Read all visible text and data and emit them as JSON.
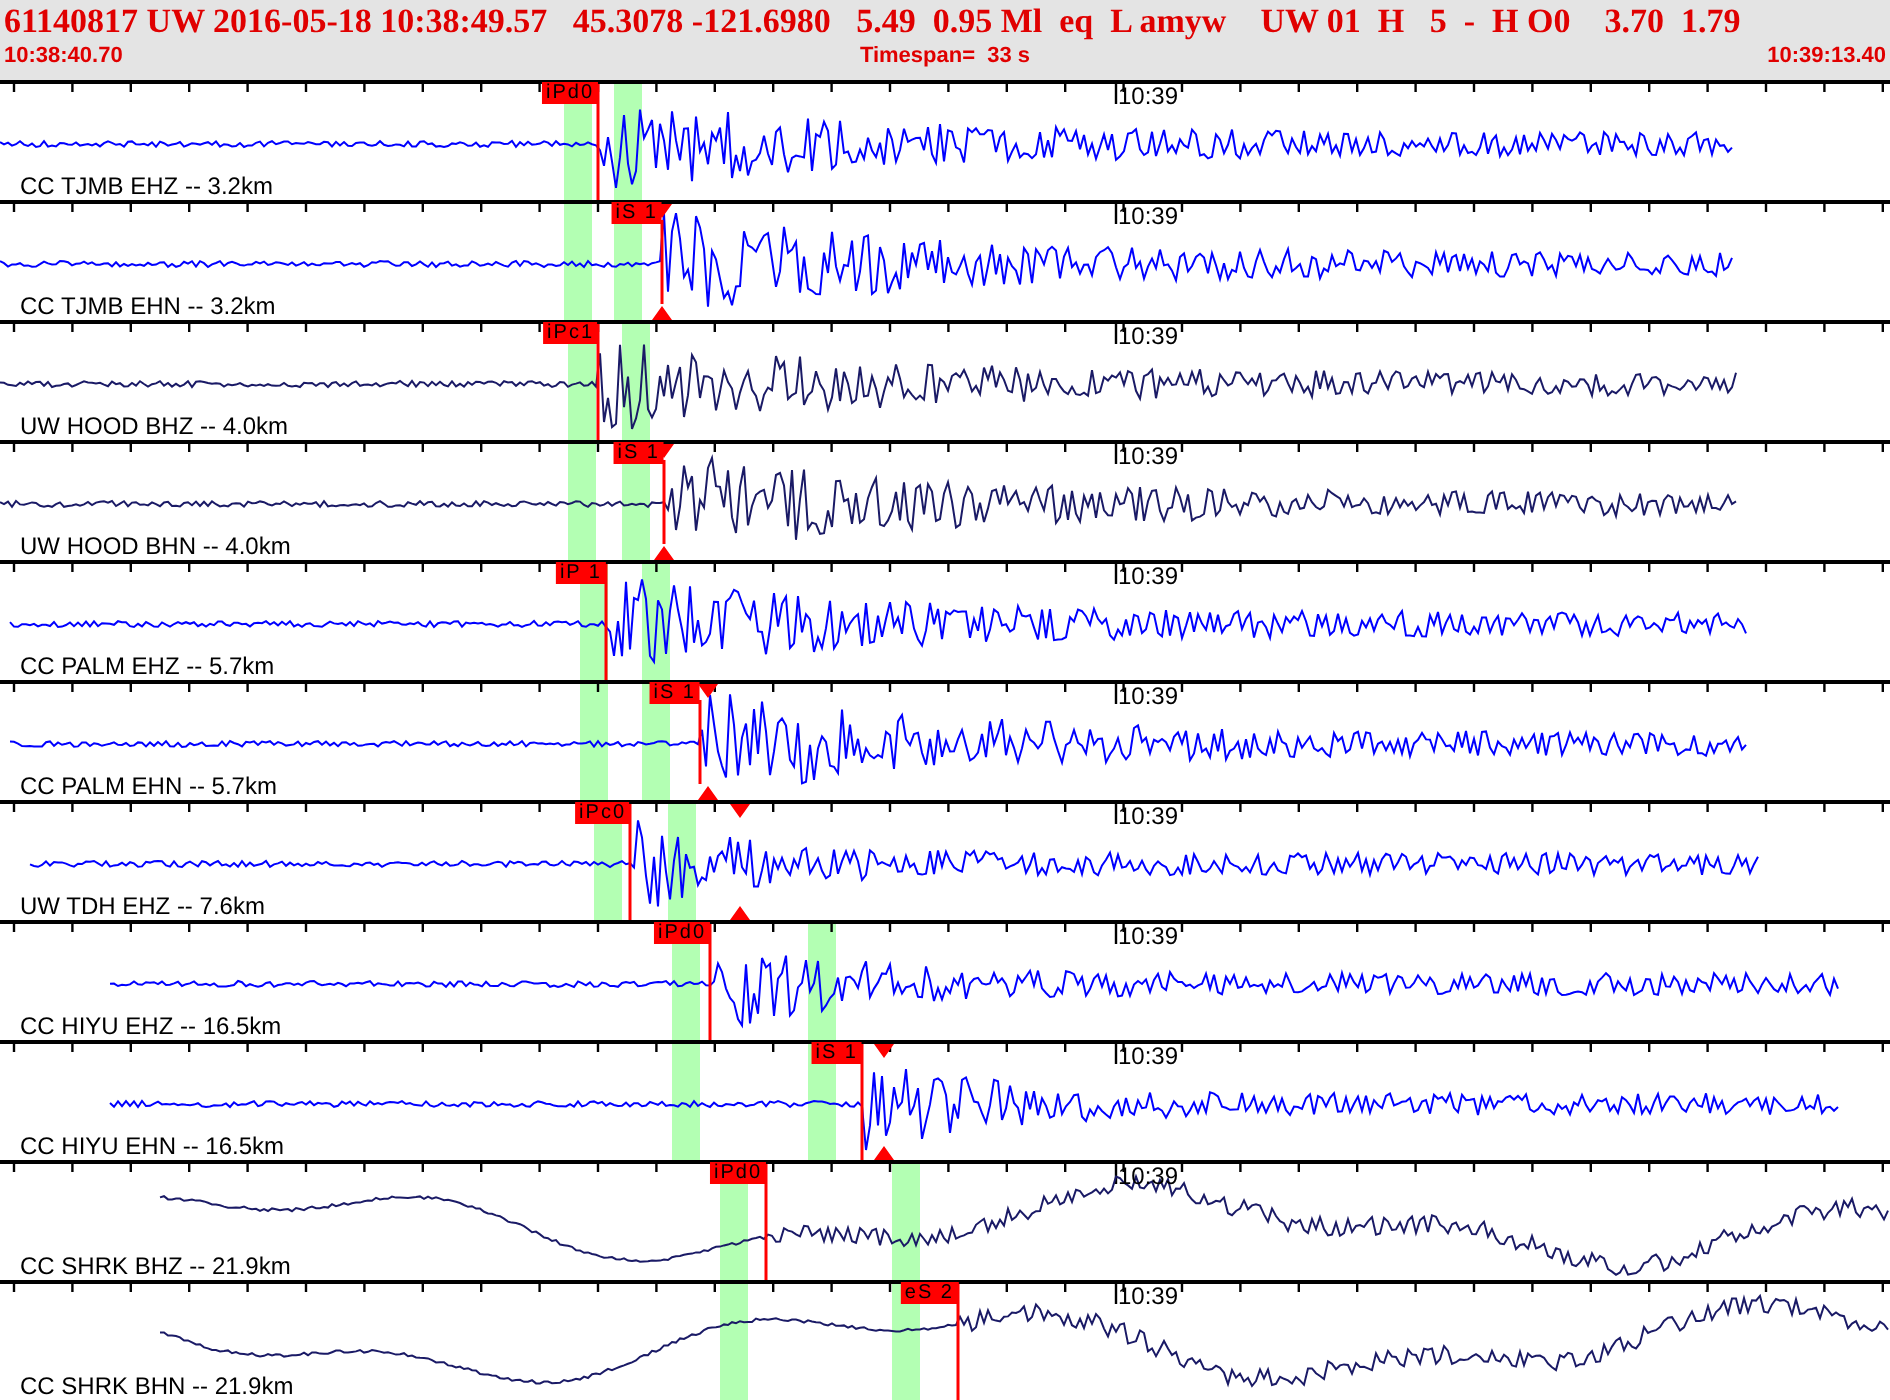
{
  "header": {
    "event_line": "61140817 UW 2016-05-18 10:38:49.57   45.3078 -121.6980   5.49  0.95 Ml  eq  L amyw    UW 01  H   5  -  H O0    3.70  1.79",
    "start_time": "10:38:40.70",
    "timespan": "Timespan=  33 s",
    "end_time": "10:39:13.40"
  },
  "traces": [
    {
      "label": "CC TJMB EHZ -- 3.2km",
      "time_mark": "10:39",
      "pick": "iPd0",
      "color": "#0000ff",
      "kind": "short-period",
      "amplitude_marker": false
    },
    {
      "label": "CC TJMB EHN -- 3.2km",
      "time_mark": "10:39",
      "pick": "iS 1",
      "color": "#0000ff",
      "kind": "short-period",
      "amplitude_marker": true
    },
    {
      "label": "UW HOOD BHZ -- 4.0km",
      "time_mark": "10:39",
      "pick": "iPc1",
      "color": "#1a1a66",
      "kind": "short-period",
      "amplitude_marker": false
    },
    {
      "label": "UW HOOD BHN -- 4.0km",
      "time_mark": "10:39",
      "pick": "iS 1",
      "color": "#1a1a66",
      "kind": "short-period",
      "amplitude_marker": true
    },
    {
      "label": "CC PALM EHZ -- 5.7km",
      "time_mark": "10:39",
      "pick": "iP 1",
      "color": "#0000ff",
      "kind": "short-period",
      "amplitude_marker": false
    },
    {
      "label": "CC PALM EHN -- 5.7km",
      "time_mark": "10:39",
      "pick": "iS 1",
      "color": "#0000ff",
      "kind": "short-period",
      "amplitude_marker": true
    },
    {
      "label": "UW TDH EHZ -- 7.6km",
      "time_mark": "10:39",
      "pick": "iPc0",
      "color": "#0000ff",
      "kind": "short-period",
      "amplitude_marker": true
    },
    {
      "label": "CC HIYU EHZ -- 16.5km",
      "time_mark": "10:39",
      "pick": "iPd0",
      "color": "#0000ff",
      "kind": "short-period",
      "amplitude_marker": false
    },
    {
      "label": "CC HIYU EHN -- 16.5km",
      "time_mark": "10:39",
      "pick": "iS 1",
      "color": "#0000ff",
      "kind": "short-period",
      "amplitude_marker": true
    },
    {
      "label": "CC SHRK BHZ -- 21.9km",
      "time_mark": "10:39",
      "pick": "iPd0",
      "color": "#1a1a66",
      "kind": "long-period",
      "amplitude_marker": false
    },
    {
      "label": "CC SHRK BHN -- 21.9km",
      "time_mark": "10:39",
      "pick": "eS 2",
      "color": "#1a1a66",
      "kind": "long-period",
      "amplitude_marker": false
    }
  ]
}
